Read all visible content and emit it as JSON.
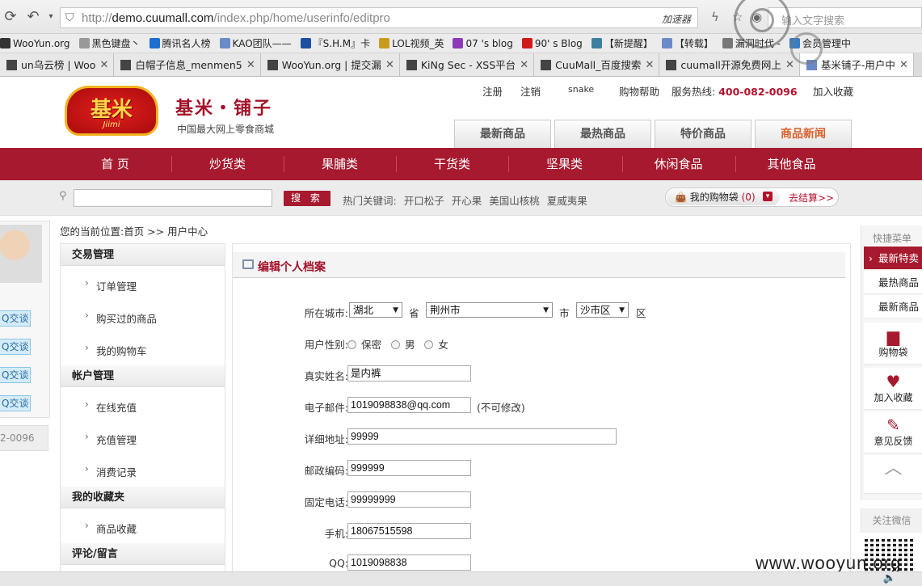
{
  "browser": {
    "url_prefix": "http://",
    "url_domain": "demo.cuumall.com",
    "url_path": "/index.php/home/userinfo/editpro",
    "accelerator": "加速器",
    "search_placeholder": "输入文字搜索",
    "bookmarks": [
      {
        "label": "WooYun.org",
        "color": "#333"
      },
      {
        "label": "黑色键盘丶",
        "color": "#999"
      },
      {
        "label": "腾讯名人榜",
        "color": "#1e6fd0"
      },
      {
        "label": "KAO团队——",
        "color": "#6a8ac8"
      },
      {
        "label": "『S.H.M』卡",
        "color": "#1d4fa1"
      },
      {
        "label": "LOL视频_英",
        "color": "#c99b1d"
      },
      {
        "label": "07 's blog",
        "color": "#8e3ab8"
      },
      {
        "label": "90' s Blog",
        "color": "#d01a1a"
      },
      {
        "label": "【新提醒】",
        "color": "#3c7f9e"
      },
      {
        "label": "【转载】",
        "color": "#6a8ac8"
      },
      {
        "label": "漏洞时代 -",
        "color": "#777"
      },
      {
        "label": "会员管理中",
        "color": "#3a7dc2"
      }
    ],
    "tabs": [
      {
        "label": "un乌云榜 | Woo",
        "active": false
      },
      {
        "label": "白帽子信息_menmen5",
        "active": false
      },
      {
        "label": "WooYun.org | 提交漏",
        "active": false
      },
      {
        "label": "KiNg Sec - XSS平台",
        "active": false
      },
      {
        "label": "CuuMall_百度搜索",
        "active": false
      },
      {
        "label": "cuumall开源免费网上",
        "active": false
      },
      {
        "label": "基米铺子-用户中",
        "active": true
      }
    ]
  },
  "header": {
    "logo_text": "基米",
    "logo_sub": "Jiimi",
    "brand_title": "基米・铺子",
    "brand_sub": "中国最大网上零食商城",
    "links": {
      "register": "注册",
      "logout": "注销",
      "user": "snake",
      "help": "购物帮助"
    },
    "hotline_label": "服务热线:",
    "hotline": "400-082-0096",
    "favorite": "加入收藏",
    "top_tabs": [
      "最新商品",
      "最热商品",
      "特价商品",
      "商品新闻"
    ]
  },
  "nav": [
    "首 页",
    "炒货类",
    "果脯类",
    "干货类",
    "坚果类",
    "休闲食品",
    "其他食品"
  ],
  "search": {
    "button": "搜 索",
    "hot_label": "热门关键词:",
    "hot": [
      "开口松子",
      "开心果",
      "美国山核桃",
      "夏威夷果"
    ],
    "cart_label": "我的购物袋",
    "cart_count": "(0)",
    "checkout": "去结算>>"
  },
  "left_float": {
    "qq": [
      "Q交谈",
      "Q交谈",
      "Q交谈",
      "Q交谈"
    ],
    "phone": "2-0096"
  },
  "breadcrumb": "您的当前位置:首页 >> 用户中心",
  "sidebar": {
    "sections": [
      {
        "title": "交易管理",
        "items": [
          "订单管理",
          "购买过的商品",
          "我的购物车"
        ]
      },
      {
        "title": "帐户管理",
        "items": [
          "在线充值",
          "充值管理",
          "消费记录"
        ]
      },
      {
        "title": "我的收藏夹",
        "items": [
          "商品收藏"
        ]
      },
      {
        "title": "评论/留言",
        "items": []
      }
    ]
  },
  "form": {
    "title": "编辑个人档案",
    "city_label": "所在城市:",
    "province": "湖北",
    "province_unit": "省",
    "city": "荆州市",
    "city_unit": "市",
    "district": "沙市区",
    "district_unit": "区",
    "gender_label": "用户性别:",
    "gender_options": [
      "保密",
      "男",
      "女"
    ],
    "name_label": "真实姓名:",
    "name": "是内裤",
    "email_label": "电子邮件:",
    "email": "1019098838@qq.com",
    "email_note": "(不可修改)",
    "address_label": "详细地址:",
    "address": "99999",
    "zip_label": "邮政编码:",
    "zip": "999999",
    "tel_label": "固定电话:",
    "tel": "99999999",
    "mobile_label": "手机:",
    "mobile": "18067515598",
    "qq_label": "QQ:",
    "qq": "1019098838"
  },
  "quick": {
    "title": "快捷菜单",
    "items": [
      "最新特卖",
      "最热商品",
      "最新商品"
    ],
    "boxes": [
      "购物袋",
      "加入收藏",
      "意见反馈"
    ],
    "weixin": "关注微信"
  },
  "watermark": "www.wooyun.org",
  "colors": {
    "brand_red": "#a6192e",
    "price_red": "#b3122c",
    "tab_active": "#d9622b"
  }
}
